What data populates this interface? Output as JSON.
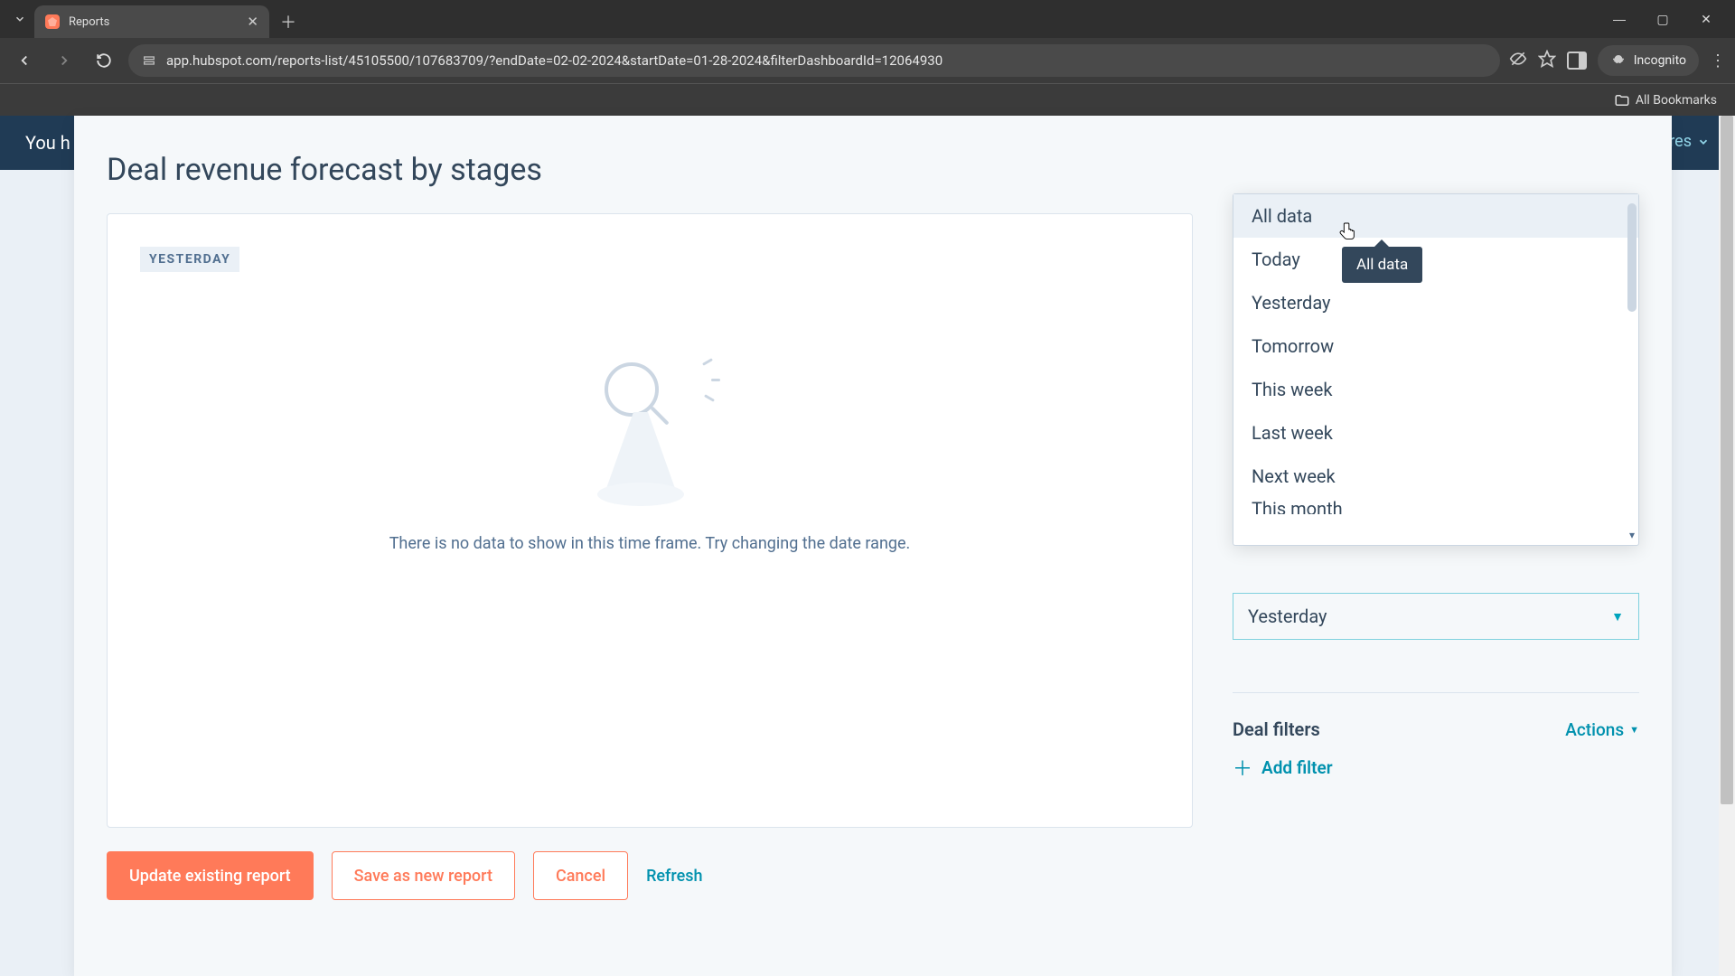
{
  "browser": {
    "tab_title": "Reports",
    "url": "app.hubspot.com/reports-list/45105500/107683709/?endDate=02-02-2024&startDate=01-28-2024&filterDashboardId=12064930",
    "incognito_label": "Incognito",
    "all_bookmarks": "All Bookmarks"
  },
  "bg": {
    "you_text": "You h"
  },
  "page": {
    "title": "Deal revenue forecast by stages",
    "badge": "YESTERDAY",
    "empty_message": "There is no data to show in this time frame. Try changing the date range."
  },
  "dropdown": {
    "options": [
      "All data",
      "Today",
      "Yesterday",
      "Tomorrow",
      "This week",
      "Last week",
      "Next week",
      "This month"
    ],
    "tooltip": "All data",
    "selected": "Yesterday"
  },
  "filters": {
    "section_title": "Deal filters",
    "actions_label": "Actions",
    "add_filter": "Add filter"
  },
  "buttons": {
    "update": "Update existing report",
    "save_new": "Save as new report",
    "cancel": "Cancel",
    "refresh": "Refresh"
  },
  "topright": {
    "label": "res"
  }
}
